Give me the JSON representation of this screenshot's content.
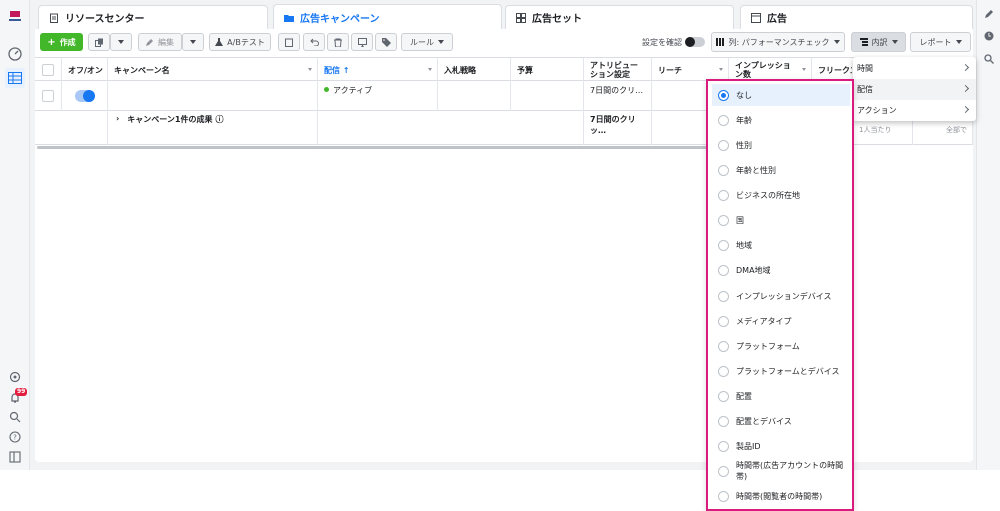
{
  "tabs": [
    {
      "label": "リソースセンター"
    },
    {
      "label": "広告キャンペーン"
    },
    {
      "label": "広告セット"
    },
    {
      "label": "広告"
    }
  ],
  "toolbar": {
    "create": "作成",
    "edit": "編集",
    "ab_test": "A/Bテスト",
    "rules": "ルール",
    "confirm_settings": "設定を確認",
    "columns": "列: パフォーマンスチェック",
    "breakdown": "内訳",
    "report": "レポート"
  },
  "table": {
    "headers": [
      "オフ/オン",
      "キャンペーン名",
      "配信 ↑",
      "入札戦略",
      "予算",
      "アトリビューション設定",
      "リーチ",
      "インプレッション数",
      "フリークエンシー"
    ],
    "row1": {
      "delivery": "アクティブ",
      "attribution": "7日間のクリ…"
    },
    "summary": {
      "label": "キャンペーン1件の成果",
      "attribution": "7日間のクリッ…",
      "per_person": "1人当たり",
      "all": "全部で"
    }
  },
  "breakdown_menu": {
    "items": [
      {
        "label": "時間"
      },
      {
        "label": "配信"
      },
      {
        "label": "アクション"
      }
    ]
  },
  "delivery_submenu": {
    "selected": "なし",
    "options": [
      "なし",
      "年齢",
      "性別",
      "年齢と性別",
      "ビジネスの所在地",
      "国",
      "地域",
      "DMA地域",
      "インプレッションデバイス",
      "メディアタイプ",
      "プラットフォーム",
      "プラットフォームとデバイス",
      "配置",
      "配置とデバイス",
      "製品ID",
      "時間帯(広告アカウントの時間帯)",
      "時間帯(閲覧者の時間帯)"
    ]
  },
  "notifications": {
    "count": "99"
  },
  "colors": {
    "accent": "#1877f2",
    "highlight": "#d81b7d",
    "create": "#42b72a"
  }
}
